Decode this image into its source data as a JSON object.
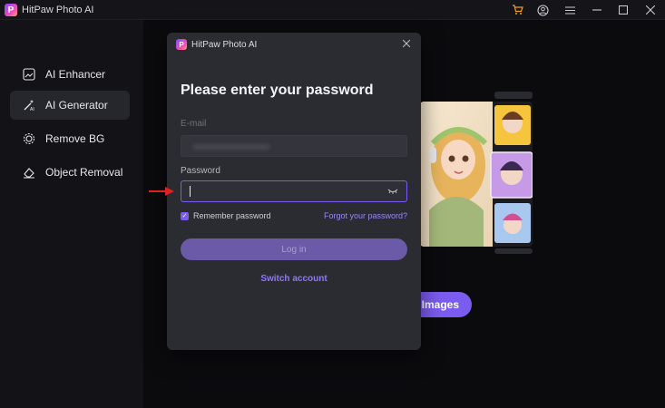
{
  "titlebar": {
    "app_title": "HitPaw Photo AI",
    "logo_letter": "P",
    "icons": [
      "cart-icon",
      "user-icon",
      "menu-icon",
      "minimize-icon",
      "maximize-icon",
      "close-icon"
    ]
  },
  "sidebar": {
    "items": [
      {
        "label": "AI Enhancer",
        "icon": "ai-enhancer-icon",
        "active": false
      },
      {
        "label": "AI Generator",
        "icon": "ai-generator-icon",
        "active": true
      },
      {
        "label": "Remove BG",
        "icon": "remove-bg-icon",
        "active": false
      },
      {
        "label": "Object Removal",
        "icon": "eraser-icon",
        "active": false
      }
    ]
  },
  "main": {
    "generate_button_label": "l Images"
  },
  "dialog": {
    "title": "HitPaw Photo AI",
    "logo_letter": "P",
    "heading": "Please enter your password",
    "email_label": "E-mail",
    "email_value": "",
    "password_label": "Password",
    "password_value": "",
    "remember_label": "Remember password",
    "remember_checked": true,
    "forgot_label": "Forgot your password?",
    "login_label": "Log in",
    "switch_account_label": "Switch account"
  },
  "colors": {
    "accent": "#7b5cf0",
    "annotation_arrow": "#e02020"
  }
}
